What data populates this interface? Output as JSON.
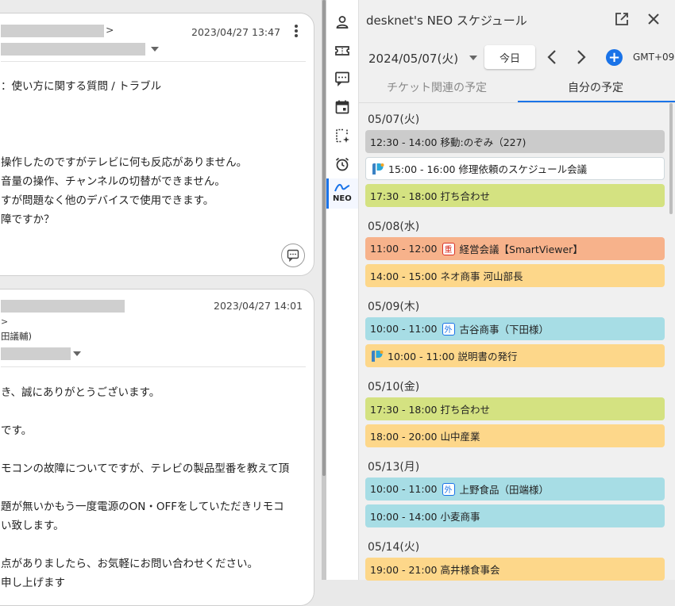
{
  "left": {
    "card1": {
      "sender_suffix": ">",
      "timestamp": "2023/04/27 13:47",
      "lines": [
        "：使い方に関する質問 / トラブル",
        "操作したのですがテレビに何も反応がありません。",
        "音量の操作、チャンネルの切替ができません。",
        "すが問題なく他のデバイスで使用できます。",
        "障ですか？"
      ]
    },
    "card2": {
      "timestamp": "2023/04/27 14:01",
      "sender_suffix": ">",
      "sender_name_fragment": "田議輔)",
      "lines": [
        "き、誠にありがとうございます。",
        "です。",
        "モコンの故障についてですが、テレビの製品型番を教えて頂",
        "題が無いかもう一度電源のON・OFFをしていただきリモコ",
        "い致します。",
        "点がありましたら、お気軽にお問い合わせください。",
        "申し上げます"
      ]
    }
  },
  "iconbar": {
    "items": [
      "person-icon",
      "ticket-icon",
      "comment-icon",
      "calendar-icon",
      "sparkle-note-icon",
      "alarm-icon",
      "neo-icon"
    ],
    "neo_label": "NEO"
  },
  "panel": {
    "title": "desknet's NEO スケジュール",
    "date": "2024/05/07(火)",
    "today_label": "今日",
    "timezone": "GMT+09",
    "tabs": [
      "チケット関連の予定",
      "自分の予定"
    ],
    "active_tab": 1,
    "days": [
      {
        "label": "05/07(火)",
        "events": [
          {
            "text": "12:30 - 14:00 移動:のぞみ（227)",
            "color": "gray"
          },
          {
            "text": "15:00 - 16:00 修理依頼のスケジュール会議",
            "color": "white",
            "logo": true
          },
          {
            "text": "17:30 - 18:00 打ち合わせ",
            "color": "green"
          }
        ]
      },
      {
        "label": "05/08(水)",
        "events": [
          {
            "text": "経営会議【SmartViewer】",
            "time": "11:00 - 12:00",
            "badge": "重",
            "color": "orange"
          },
          {
            "text": "14:00 - 15:00 ネオ商事 河山部長",
            "color": "yellow"
          }
        ]
      },
      {
        "label": "05/09(木)",
        "events": [
          {
            "text": "古谷商事（下田様）",
            "time": "10:00 - 11:00",
            "badge": "外",
            "color": "cyan"
          },
          {
            "text": "10:00 - 11:00 説明書の発行",
            "color": "yellow",
            "logo": true
          }
        ]
      },
      {
        "label": "05/10(金)",
        "events": [
          {
            "text": "17:30 - 18:00 打ち合わせ",
            "color": "green"
          },
          {
            "text": "18:00 - 20:00 山中産業",
            "color": "yellow"
          }
        ]
      },
      {
        "label": "05/13(月)",
        "events": [
          {
            "text": "上野食品（田端様）",
            "time": "10:00 - 11:00",
            "badge": "外",
            "color": "cyan"
          },
          {
            "text": "10:00 - 14:00 小麦商事",
            "color": "cyan"
          }
        ]
      },
      {
        "label": "05/14(火)",
        "events": [
          {
            "text": "19:00 - 21:00 高井様食事会",
            "color": "yellow"
          }
        ]
      }
    ]
  },
  "colors": {
    "accent": "#1a73e8",
    "badge_red": "#d93025",
    "badge_blue": "#1a73e8"
  }
}
